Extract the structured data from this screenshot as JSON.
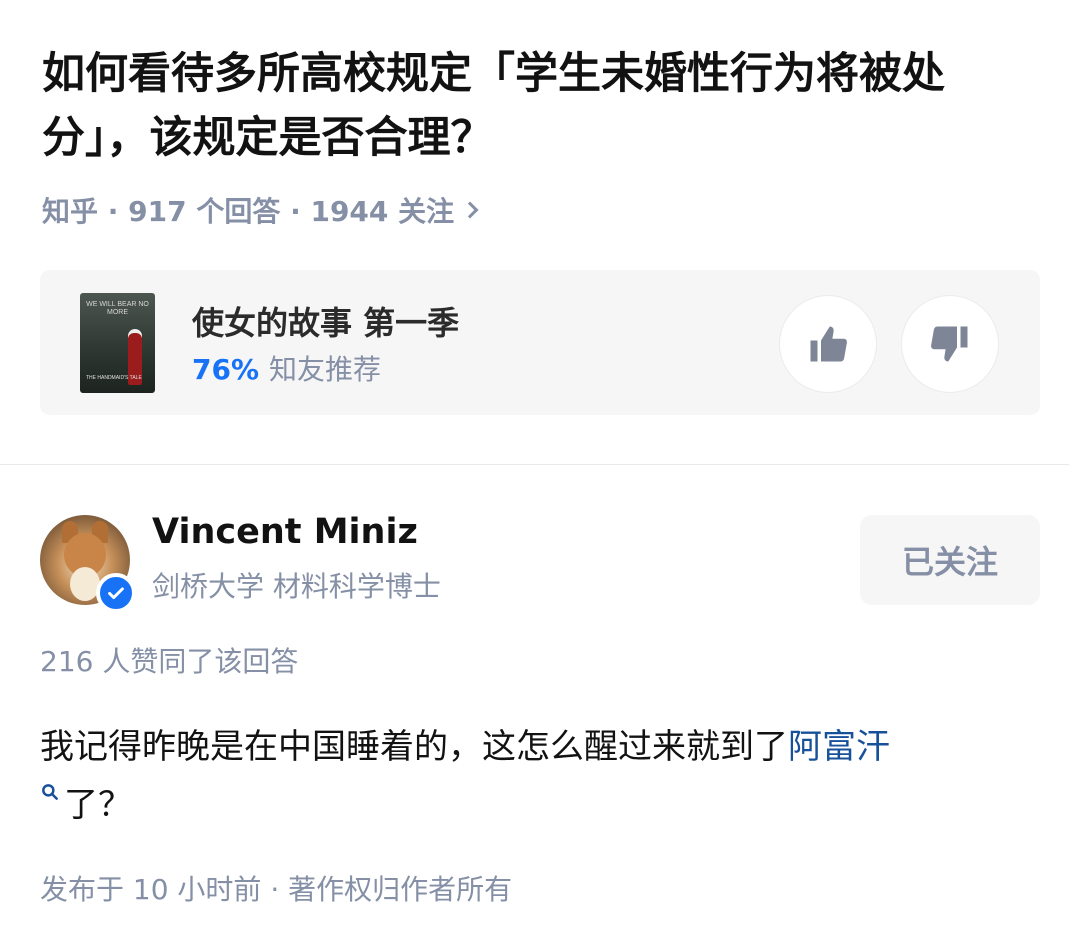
{
  "question": {
    "title": "如何看待多所高校规定「学生未婚性行为将被处分」，该规定是否合理？",
    "meta": "知乎 · 917 个回答 · 1944 关注"
  },
  "card": {
    "poster_text": "WE WILL BEAR NO MORE",
    "poster_title": "THE HANDMAID'S TALE",
    "title": "使女的故事 第一季",
    "rating_percent": "76%",
    "rating_label": "知友推荐",
    "thumbs_up_icon": "thumbs-up-icon",
    "thumbs_down_icon": "thumbs-down-icon"
  },
  "author": {
    "name": "Vincent Miniz",
    "bio": "剑桥大学 材料科学博士",
    "follow_label": "已关注",
    "verified_icon": "verified-badge-icon",
    "accent": "#1772f6"
  },
  "answer": {
    "agree_text": "216 人赞同了该回答",
    "text_before": "我记得昨晚是在中国睡着的，这怎么醒过来就到了",
    "keyword": "阿富汗",
    "text_after": "了？",
    "published": "发布于 10 小时前 · 著作权归作者所有"
  }
}
